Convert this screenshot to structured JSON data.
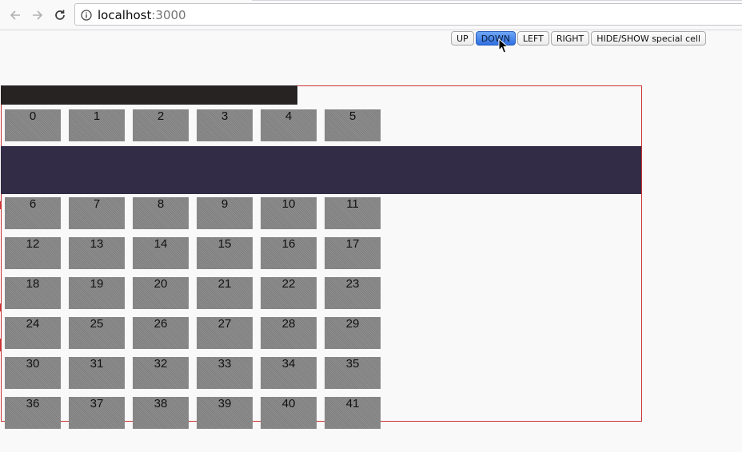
{
  "browser": {
    "url_host": "localhost",
    "url_port": ":3000",
    "icons": [
      "back-arrow-icon",
      "forward-arrow-icon",
      "reload-icon",
      "info-icon"
    ]
  },
  "controls": {
    "buttons": [
      {
        "label": "UP",
        "active": false
      },
      {
        "label": "DOWN",
        "active": true
      },
      {
        "label": "LEFT",
        "active": false
      },
      {
        "label": "RIGHT",
        "active": false
      },
      {
        "label": "HIDE/SHOW special cell",
        "active": false
      }
    ],
    "active_color": "#3b78e7"
  },
  "grid": {
    "cells": [
      "0",
      "1",
      "2",
      "3",
      "4",
      "5",
      "6",
      "7",
      "8",
      "9",
      "10",
      "11",
      "12",
      "13",
      "14",
      "15",
      "16",
      "17",
      "18",
      "19",
      "20",
      "21",
      "22",
      "23",
      "24",
      "25",
      "26",
      "27",
      "28",
      "29",
      "30",
      "31",
      "32",
      "33",
      "34",
      "35",
      "36",
      "37",
      "38",
      "39",
      "40",
      "41"
    ],
    "special_cell_color": "#332c46",
    "border_color": "#cc3333"
  }
}
